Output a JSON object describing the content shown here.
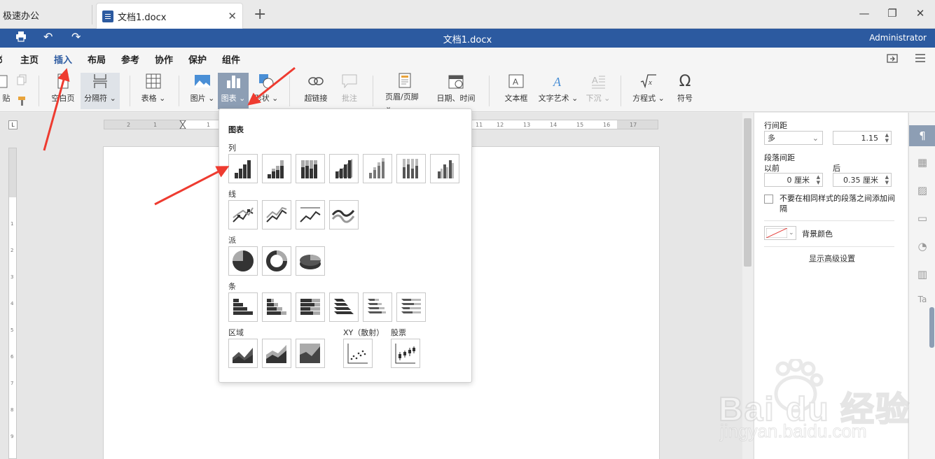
{
  "tabs": {
    "app_name": "极速办公",
    "doc_name": "文档1.docx"
  },
  "titlebar": {
    "title": "文档1.docx",
    "user": "Administrator"
  },
  "menu": [
    "主页",
    "插入",
    "布局",
    "参考",
    "协作",
    "保护",
    "组件"
  ],
  "menu_active": "插入",
  "ribbon": {
    "paste_fragment": "贴",
    "blank_page": "空白页",
    "separator": "分隔符",
    "table": "表格",
    "image": "图片",
    "chart": "图表",
    "shape": "形状",
    "hyperlink": "超链接",
    "comment": "批注",
    "header_footer": "页眉/页脚",
    "datetime": "日期、时间",
    "textbox": "文本框",
    "textart": "文字艺术",
    "dropcap": "下沉",
    "equation": "方程式",
    "symbol": "符号"
  },
  "chart_menu": {
    "title": "图表",
    "sections": {
      "column": "列",
      "line": "线",
      "pie": "派",
      "bar": "条",
      "area": "区域",
      "xy": "XY（散射）",
      "stock": "股票"
    }
  },
  "panel": {
    "line_spacing_label": "行间距",
    "line_spacing_mode": "多",
    "line_spacing_value": "1.15",
    "para_spacing_label": "段落间距",
    "before_label": "以前",
    "after_label": "后",
    "before_value": "0 厘米",
    "after_value": "0.35 厘米",
    "no_add_checkbox": "不要在相同样式的段落之间添加间隔",
    "background_color": "背景颜色",
    "advanced": "显示高级设置"
  },
  "icons": {
    "print": "print-icon",
    "undo": "undo-icon",
    "redo": "redo-icon",
    "open_location": "open-location-icon",
    "hamburger": "hamburger-icon"
  },
  "colors": {
    "accent": "#2c5aa0",
    "arrow": "#ee3b30",
    "selected": "#8d9eb4"
  },
  "watermark": {
    "brand": "Bai du 经验",
    "url": "jingyan.baidu.com"
  }
}
